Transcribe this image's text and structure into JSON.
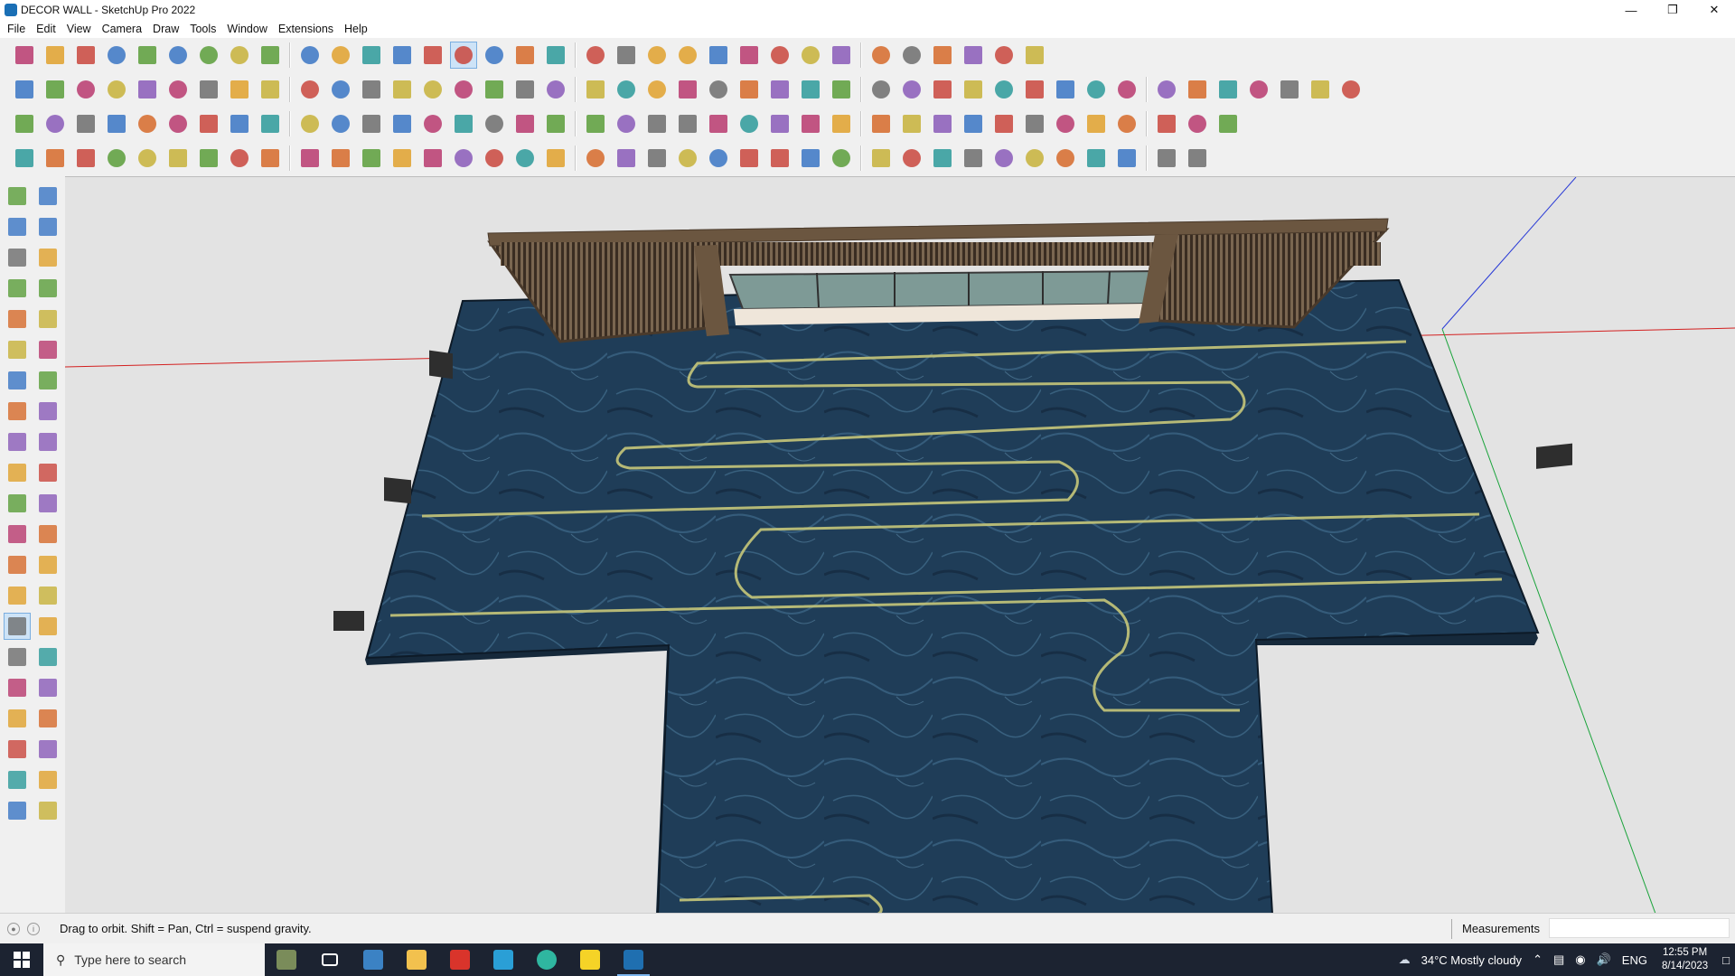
{
  "window": {
    "title": "DECOR WALL - SketchUp Pro 2022",
    "controls": [
      "—",
      "❐",
      "✕"
    ]
  },
  "menu": [
    "File",
    "Edit",
    "View",
    "Camera",
    "Draw",
    "Tools",
    "Window",
    "Extensions",
    "Help"
  ],
  "toolbar_rows": [
    {
      "icons": [
        "zoom-icon",
        "select-icon",
        "eraser-icon",
        "pencil-icon",
        "freehand-icon",
        "rectangle-icon",
        "pushpull-icon",
        "followme-icon",
        "move-icon",
        "rotate-icon",
        "scale-icon",
        "tape-icon",
        "text-icon",
        "paint-icon",
        "orbit-icon",
        "pan-icon",
        "zoomwin-icon",
        "zoomext-icon",
        "layers-icon",
        "outliner-icon",
        "components-icon",
        "styles-icon",
        "warehouse-icon",
        "extension-icon",
        "blue-face-icon",
        "axis-icon",
        "up-arrows-icon",
        "down-arrows-icon",
        "measure-icon",
        "section-icon",
        "undo-icon",
        "redo-icon",
        "hand-icon"
      ]
    },
    {
      "icons": [
        "cube-icon",
        "shade-icon",
        "wire-icon",
        "solid-tools-icon",
        "push-icon",
        "join-push-icon",
        "red-push-icon",
        "green-push-icon",
        "orange-push-icon",
        "magenta-push-icon",
        "curve-icon",
        "section-plane-icon",
        "blue-plane-icon",
        "purple-plane-icon",
        "green-shape-icon",
        "lime-shape-icon",
        "house-icon",
        "door-icon",
        "home-icon",
        "roof-icon",
        "wall-icon",
        "sign-icon",
        "label-icon",
        "knife-icon",
        "shape-rect-icon",
        "shape-circle-icon",
        "shape-hex-icon",
        "shape-ellipse-icon",
        "shape-para-icon",
        "shape-arc-icon",
        "shape-gear-icon",
        "shape-star-icon",
        "polyline-icon",
        "spiral-icon",
        "red-tool-icon",
        "pink-tool-icon",
        "texture1-icon",
        "texture2-icon",
        "texture3-icon",
        "texture4-icon",
        "texture5-icon",
        "texture6-icon",
        "texture7-icon"
      ]
    },
    {
      "icons": [
        "blue-face1-icon",
        "blue-face2-icon",
        "yellow-face-icon",
        "text-style-icon",
        "red-cube-icon",
        "red-fill-icon",
        "rotate-orange-icon",
        "square-red-icon",
        "grid-icon",
        "frame-icon",
        "wood-icon",
        "pipe-icon",
        "corner-icon",
        "dot-path-icon",
        "cross-icon",
        "green-plus-icon",
        "blue-x-icon",
        "cone-icon",
        "tent-icon",
        "warning-icon",
        "ring-icon",
        "cut-icon",
        "spring-icon",
        "move-four-icon",
        "cup-icon",
        "hook-icon",
        "puzzle-icon",
        "gear2-icon",
        "red-gear-icon",
        "orange-gear-icon",
        "red-gem-icon",
        "parts-icon",
        "panel-icon",
        "orange-grid-icon",
        "orange-block-icon",
        "orange-tile-icon",
        "red-x-icon",
        "circle-dots-icon",
        "qr-icon"
      ]
    },
    {
      "icons": [
        "vertex-icon",
        "bezier-icon",
        "red-car-icon",
        "line-draw-icon",
        "curve2-icon",
        "slide-icon",
        "twist-icon",
        "box3d-icon",
        "sphere-icon",
        "fold-icon",
        "angle-icon",
        "angle2-icon",
        "red-line-icon",
        "swoosh-icon",
        "bevel-icon",
        "lamp-icon",
        "column-icon",
        "column2-icon",
        "fan-icon",
        "leaf-icon",
        "arrow-leaf-icon",
        "stair-icon",
        "slope-icon",
        "hatch-icon",
        "hatch2-icon",
        "hatch3-icon",
        "vent-icon",
        "diag-icon",
        "tile-icon",
        "tile2-icon",
        "grid2-icon",
        "lattice-icon",
        "comb-icon",
        "fan2-icon",
        "fan3-icon",
        "stripe-icon",
        "pattern-icon",
        "mask-icon"
      ]
    }
  ],
  "left_tools": [
    "select-tool",
    "orbit-tool",
    "paint-tool",
    "eraser-tool",
    "component-tool",
    "pencil-tool",
    "line-tool",
    "arc-squiggle-tool",
    "rect-tool",
    "rotated-rect-tool",
    "circle-tool",
    "polygon-tool",
    "arc-tool",
    "arc2-tool",
    "pie-tool",
    "arc3-tool",
    "move-tool",
    "pushpull-tool",
    "rotate-tool",
    "followme-tool",
    "scale-tool",
    "offset-tool",
    "tape-tool",
    "dimension-tool",
    "protractor-tool",
    "text-tool",
    "axes-tool",
    "3dtext-tool",
    "orbit-active-tool",
    "pan-tool",
    "zoom-tool",
    "zoomwin-tool",
    "zoomext-tool",
    "prev-tool",
    "walk-tool",
    "lookaround-tool",
    "footprint-tool",
    "position-tool",
    "section-tool",
    "section2-tool",
    "layers-tool",
    "outliner-tool"
  ],
  "status": {
    "message": "Drag to orbit. Shift = Pan, Ctrl = suspend gravity.",
    "measurements_label": "Measurements",
    "measurements_value": ""
  },
  "taskbar": {
    "search_placeholder": "Type here to search",
    "weather": "34°C  Mostly cloudy",
    "lang": "ENG",
    "time": "12:55 PM",
    "date": "8/14/2023"
  },
  "colors": {
    "floor": "#1e3b55",
    "frame": "#6b5640",
    "glass": "#7e9a96",
    "axis_red": "#d32020",
    "axis_green": "#19a33a",
    "axis_blue": "#2a3bd6",
    "inlay": "#c6c77a"
  }
}
